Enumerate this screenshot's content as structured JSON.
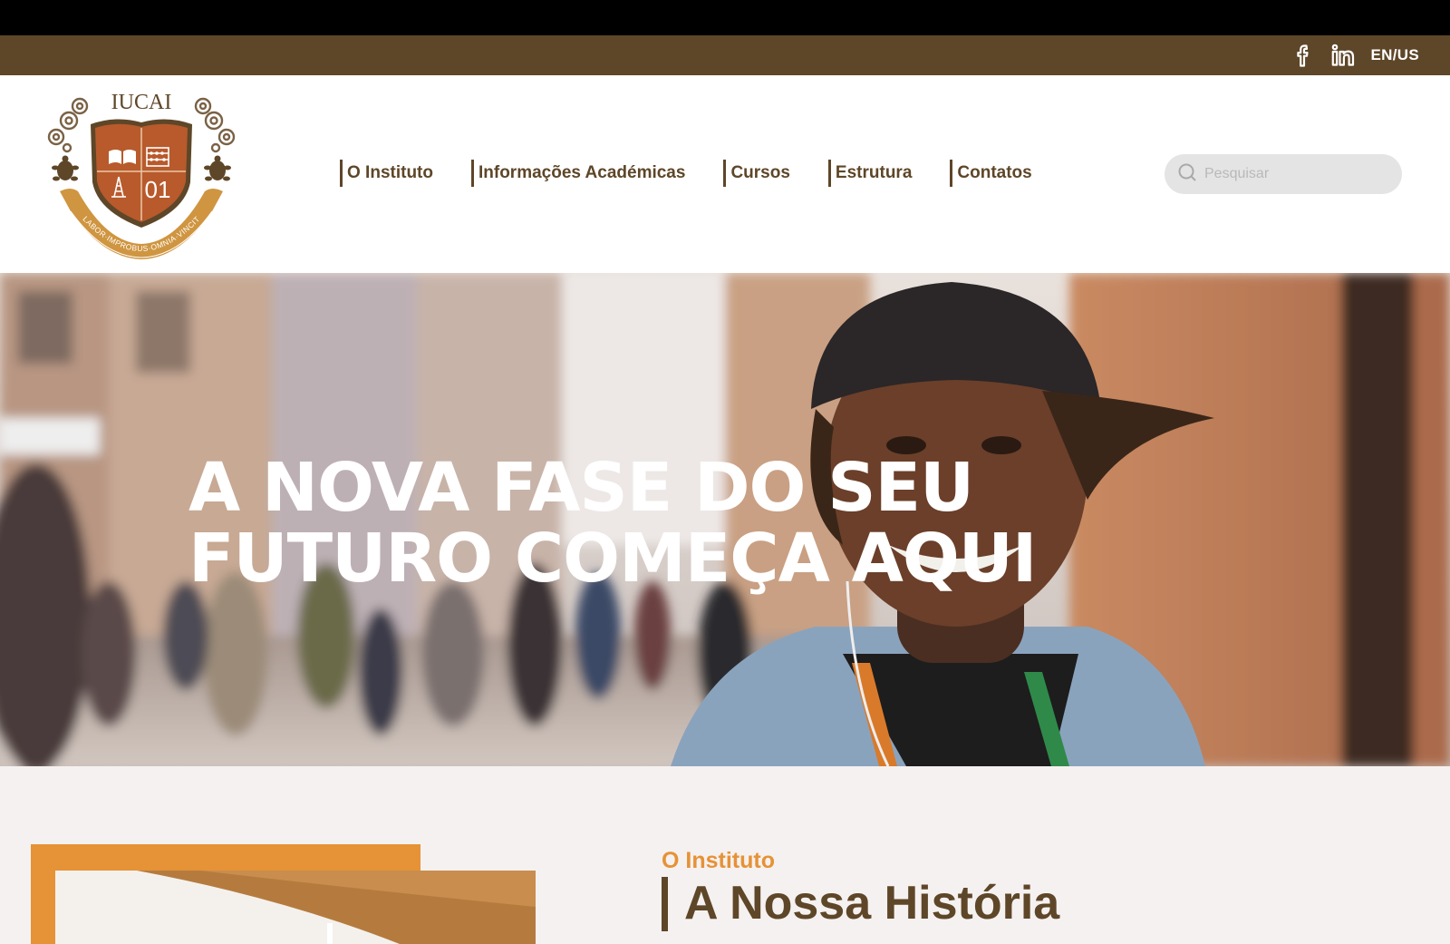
{
  "topbar": {
    "icons": [
      "facebook-icon",
      "linkedin-icon"
    ],
    "language": "EN/US"
  },
  "logo": {
    "name": "IUCAI",
    "number": "01",
    "motto": "LABOR·IMPROBUS·OMNIA·VINCIT"
  },
  "nav": {
    "items": [
      {
        "label": "O Instituto"
      },
      {
        "label": "Informações Académicas"
      },
      {
        "label": "Cursos"
      },
      {
        "label": "Estrutura"
      },
      {
        "label": "Contatos"
      }
    ]
  },
  "search": {
    "placeholder": "Pesquisar",
    "value": ""
  },
  "hero": {
    "headline_line1": "A NOVA FASE DO SEU",
    "headline_line2": "FUTURO COMEÇA AQUI"
  },
  "about": {
    "eyebrow": "O Instituto",
    "title": "A Nossa História"
  },
  "colors": {
    "brand_brown": "#5e4628",
    "accent_orange": "#e69237",
    "logo_rust": "#b85a2c",
    "section_bg": "#f5f1f0"
  }
}
